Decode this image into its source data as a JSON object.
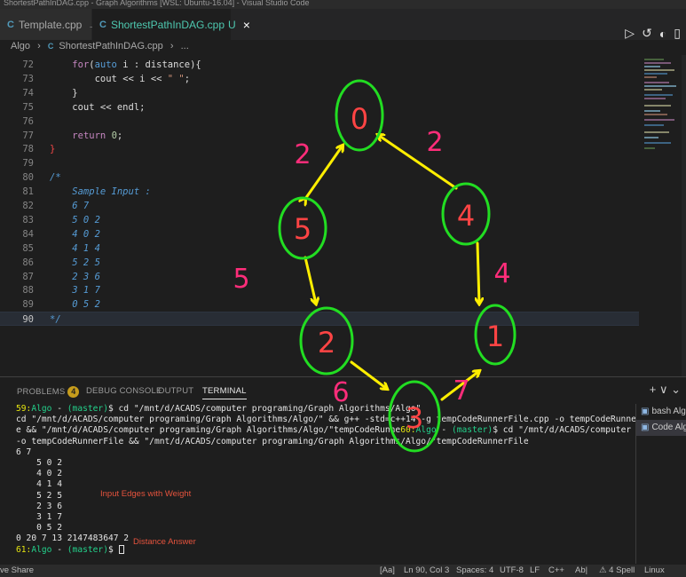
{
  "window": {
    "title": "ShortestPathInDAG.cpp - Graph Algorithms [WSL: Ubuntu-16.04] - Visual Studio Code"
  },
  "tabs": [
    {
      "label": "Template.cpp",
      "icon": "cpp-file-icon",
      "state": "pinned"
    },
    {
      "label": "ShortestPathInDAG.cpp",
      "icon": "cpp-file-icon",
      "state": "active",
      "git_status": "U"
    }
  ],
  "tab_actions": [
    "run-icon",
    "history-icon",
    "loading-icon",
    "split-editor-icon"
  ],
  "breadcrumb": [
    "Algo",
    "ShortestPathInDAG.cpp",
    "..."
  ],
  "editor": {
    "lines": [
      {
        "n": "72",
        "tokens": [
          [
            "    ",
            ""
          ],
          [
            "for",
            "kw"
          ],
          [
            "(",
            "var"
          ],
          [
            "auto",
            "kw2"
          ],
          [
            " i : distance){",
            "var"
          ]
        ]
      },
      {
        "n": "73",
        "tokens": [
          [
            "        cout ",
            "var"
          ],
          [
            "<<",
            "var"
          ],
          [
            " i ",
            "var"
          ],
          [
            "<<",
            "var"
          ],
          [
            " \" \"",
            "str"
          ],
          [
            ";",
            "var"
          ]
        ]
      },
      {
        "n": "74",
        "tokens": [
          [
            "    }",
            "var"
          ]
        ]
      },
      {
        "n": "75",
        "tokens": [
          [
            "    cout << endl;",
            "var"
          ]
        ]
      },
      {
        "n": "76",
        "tokens": []
      },
      {
        "n": "77",
        "tokens": [
          [
            "    ",
            ""
          ],
          [
            "return",
            "kw"
          ],
          [
            " ",
            ""
          ],
          [
            "0",
            "num"
          ],
          [
            ";",
            "var"
          ]
        ]
      },
      {
        "n": "78",
        "tokens": [
          [
            "}",
            "red"
          ]
        ]
      },
      {
        "n": "79",
        "tokens": []
      },
      {
        "n": "80",
        "tokens": [
          [
            "/*",
            "cmtblue"
          ]
        ]
      },
      {
        "n": "81",
        "tokens": [
          [
            "    Sample Input :",
            "cmtblue"
          ]
        ]
      },
      {
        "n": "82",
        "tokens": [
          [
            "    6 7",
            "cmtblue"
          ]
        ]
      },
      {
        "n": "83",
        "tokens": [
          [
            "    5 0 2",
            "cmtblue"
          ]
        ]
      },
      {
        "n": "84",
        "tokens": [
          [
            "    4 0 2",
            "cmtblue"
          ]
        ]
      },
      {
        "n": "85",
        "tokens": [
          [
            "    4 1 4",
            "cmtblue"
          ]
        ]
      },
      {
        "n": "86",
        "tokens": [
          [
            "    5 2 5",
            "cmtblue"
          ]
        ]
      },
      {
        "n": "87",
        "tokens": [
          [
            "    2 3 6",
            "cmtblue"
          ]
        ]
      },
      {
        "n": "88",
        "tokens": [
          [
            "    3 1 7",
            "cmtblue"
          ]
        ]
      },
      {
        "n": "89",
        "tokens": [
          [
            "    0 5 2",
            "cmtblue"
          ]
        ]
      },
      {
        "n": "90",
        "tokens": [
          [
            "*/",
            "cmtblue"
          ]
        ],
        "current": true
      }
    ]
  },
  "panel": {
    "tabs": [
      {
        "label": "PROBLEMS",
        "badge": "4"
      },
      {
        "label": "DEBUG CONSOLE"
      },
      {
        "label": "OUTPUT"
      },
      {
        "label": "TERMINAL",
        "active": true
      }
    ],
    "actions": "+ ∨ ⌄",
    "terminal_lines": [
      [
        [
          "59:",
          "t-yellow"
        ],
        [
          "Algo",
          "t-green"
        ],
        [
          " - ",
          ""
        ],
        [
          "(master)",
          "t-green"
        ],
        [
          "$ cd \"/mnt/d/ACADS/computer programing/Graph Algorithms/Algo\"",
          ""
        ]
      ],
      [
        [
          "cd \"/mnt/d/ACADS/computer programing/Graph Algorithms/Algo/\" && g++ -std=c++14 -g tempCodeRunnerFile.cpp -o tempCodeRunnerFil",
          ""
        ]
      ],
      [
        [
          "e && \"/mnt/d/ACADS/computer programing/Graph Algorithms/Algo/\"tempCodeRunne",
          ""
        ],
        [
          "60:",
          "t-yellow"
        ],
        [
          "Algo",
          "t-green"
        ],
        [
          " - ",
          ""
        ],
        [
          "(master)",
          "t-green"
        ],
        [
          "$ cd \"/mnt/d/ACADS/computer prog",
          ""
        ]
      ],
      [
        [
          "-o tempCodeRunnerFile && \"/mnt/d/ACADS/computer programing/Graph Algorithms/Algo/\"tempCodeRunnerFile",
          ""
        ]
      ],
      [
        [
          "6 7",
          ""
        ]
      ],
      [
        [
          "    5 0 2",
          ""
        ]
      ],
      [
        [
          "    4 0 2",
          ""
        ]
      ],
      [
        [
          "    4 1 4",
          ""
        ]
      ],
      [
        [
          "    5 2 5",
          ""
        ]
      ],
      [
        [
          "    2 3 6",
          ""
        ]
      ],
      [
        [
          "    3 1 7",
          ""
        ]
      ],
      [
        [
          "    0 5 2",
          ""
        ]
      ],
      [
        [
          "0 20 7 13 2147483647 2",
          ""
        ]
      ],
      [
        [
          "61:",
          "t-yellow"
        ],
        [
          "Algo",
          "t-green"
        ],
        [
          " - ",
          ""
        ],
        [
          "(master)",
          "t-green"
        ],
        [
          "$ ",
          ""
        ]
      ]
    ],
    "annotations": {
      "input_edges": "Input Edges with Weight",
      "distance_answer": "Distance Answer"
    },
    "side_items": [
      {
        "label": "bash Algo",
        "selected": false
      },
      {
        "label": "Code Algo",
        "selected": true
      }
    ]
  },
  "statusbar": {
    "live_share": "ve Share",
    "case": "[Aa]",
    "position": "Ln 90, Col 3",
    "spaces": "Spaces: 4",
    "encoding": "UTF-8",
    "eol": "LF",
    "language": "C++",
    "abc": "Ab|",
    "spell": "⚠ 4 Spell",
    "os": "Linux"
  },
  "drawing": {
    "nodes": [
      "0",
      "5",
      "4",
      "2",
      "1",
      "3"
    ],
    "weights": [
      "2",
      "2",
      "5",
      "4",
      "6",
      "7"
    ],
    "colors": {
      "circle": "#22dd22",
      "digit": "#ff4444",
      "arrow": "#ffee00",
      "weight": "#ff2d7a"
    }
  },
  "colors": {
    "editor_bg": "#1e1e1e",
    "active_tab_text": "#4ec9b0",
    "terminal_green": "#23d18b",
    "terminal_yellow": "#e5e510"
  }
}
